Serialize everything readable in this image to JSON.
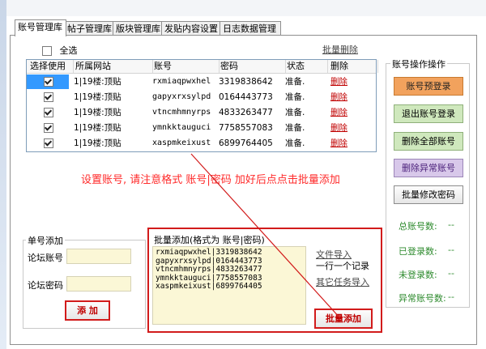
{
  "tabs": [
    "账号管理库",
    "帖子管理库",
    "版块管理库",
    "发贴内容设置",
    "日志数据管理"
  ],
  "select_all": {
    "label": "全选",
    "checked": false
  },
  "batch_delete_label": "批量删除",
  "table": {
    "columns": [
      "选择使用",
      "所属网站",
      "账号",
      "密码",
      "状态",
      "删除"
    ],
    "rows": [
      {
        "checked": true,
        "site": "1|19楼:顶贴",
        "account": "rxmiaqpwxhel",
        "password": "3319838642",
        "status": "准备.",
        "delete": "删除"
      },
      {
        "checked": true,
        "site": "1|19楼:顶贴",
        "account": "gapyxrxsylpd",
        "password": "0164443773",
        "status": "准备.",
        "delete": "删除"
      },
      {
        "checked": true,
        "site": "1|19楼:顶贴",
        "account": "vtncmhmnyrps",
        "password": "4833263477",
        "status": "准备.",
        "delete": "删除"
      },
      {
        "checked": true,
        "site": "1|19楼:顶贴",
        "account": "ymnkktauguci",
        "password": "7758557083",
        "status": "准备.",
        "delete": "删除"
      },
      {
        "checked": true,
        "site": "1|19楼:顶贴",
        "account": "xaspmkeixust",
        "password": "6899764405",
        "status": "准备.",
        "delete": "删除"
      }
    ]
  },
  "notice": "设置账号, 请注意格式 账号|密码 加好后点点击批量添加",
  "account_ops": {
    "title": "账号操作操作",
    "buttons": [
      "账号预登录",
      "退出账号登录",
      "删除全部账号",
      "删除异常账号",
      "批量修改密码"
    ]
  },
  "stats": [
    {
      "label": "总账号数:",
      "value": "--"
    },
    {
      "label": "已登录数:",
      "value": "--"
    },
    {
      "label": "未登录数:",
      "value": "--"
    },
    {
      "label": "异常账号数:",
      "value": "--"
    }
  ],
  "single_add": {
    "title": "单号添加",
    "account_label": "论坛账号",
    "password_label": "论坛密码",
    "account_value": "",
    "password_value": "",
    "add_button": "添 加"
  },
  "batch_add": {
    "title": "批量添加(格式为 账号|密码)",
    "lines": [
      "rxmiaqpwxhel|3319838642",
      "gapyxrxsylpd|0164443773",
      "vtncmhmnyrps|4833263477",
      "ymnkktauguci|7758557083",
      "xaspmkeixust|6899764405"
    ],
    "file_import": "文件导入",
    "one_per_line": "一行一个记录",
    "other_import": "其它任务导入",
    "button": "批量添加"
  },
  "colors": {
    "accent_red": "#d21b1b",
    "notice_red": "#ff2a2a",
    "selection_blue": "#3399ff",
    "orange": "#f2a25d",
    "green": "#cfe8bd",
    "purple": "#d8c8ea"
  }
}
